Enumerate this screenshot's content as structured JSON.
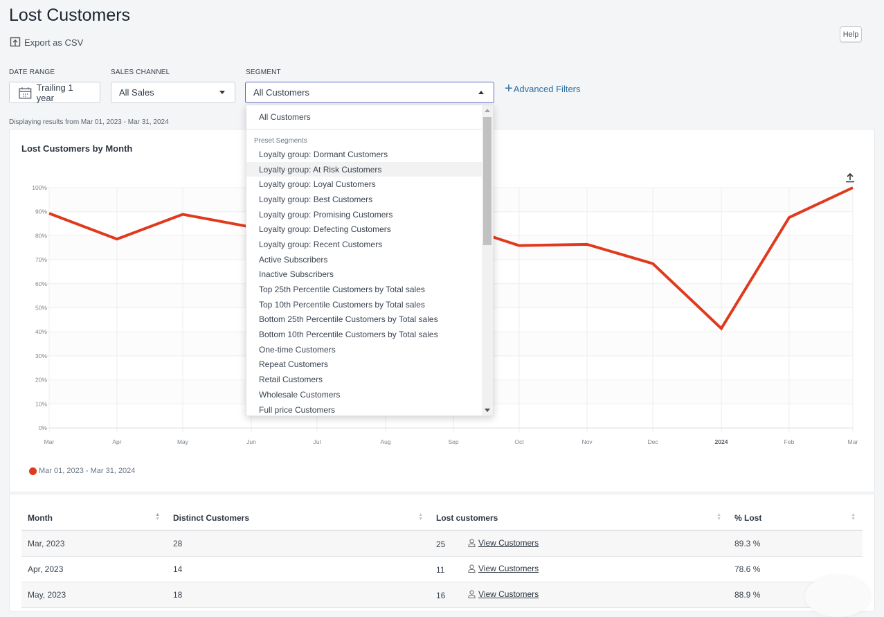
{
  "page": {
    "title": "Lost Customers",
    "export_label": "Export as CSV",
    "help_label": "Help",
    "display_text": "Displaying results from Mar 01, 2023 - Mar 31, 2024"
  },
  "filters": {
    "date_range": {
      "label": "DATE RANGE",
      "value": "Trailing 1 year"
    },
    "sales_channel": {
      "label": "SALES CHANNEL",
      "value": "All Sales"
    },
    "segment": {
      "label": "SEGMENT",
      "value": "All Customers"
    },
    "advanced_label": "Advanced Filters"
  },
  "segment_dropdown": {
    "top_option": "All Customers",
    "group_label": "Preset Segments",
    "hovered_option": "Loyalty group: At Risk Customers",
    "options": [
      "Loyalty group: Dormant Customers",
      "Loyalty group: At Risk Customers",
      "Loyalty group: Loyal Customers",
      "Loyalty group: Best Customers",
      "Loyalty group: Promising Customers",
      "Loyalty group: Defecting Customers",
      "Loyalty group: Recent Customers",
      "Active Subscribers",
      "Inactive Subscribers",
      "Top 25th Percentile Customers by Total sales",
      "Top 10th Percentile Customers by Total sales",
      "Bottom 25th Percentile Customers by Total sales",
      "Bottom 10th Percentile Customers by Total sales",
      "One-time Customers",
      "Repeat Customers",
      "Retail Customers",
      "Wholesale Customers",
      "Full price Customers"
    ]
  },
  "chart_data": {
    "type": "line",
    "title": "Lost Customers by Month",
    "xlabel": "",
    "ylabel": "",
    "x": [
      "Mar",
      "Apr",
      "May",
      "Jun",
      "Jul",
      "Aug",
      "Sep",
      "Oct",
      "Nov",
      "Dec",
      "2024",
      "Feb",
      "Mar"
    ],
    "y_ticks": [
      "0%",
      "10%",
      "20%",
      "30%",
      "40%",
      "50%",
      "60%",
      "70%",
      "80%",
      "90%",
      "100%"
    ],
    "ylim": [
      0,
      100
    ],
    "grid": true,
    "legend_position": "bottom-left",
    "series": [
      {
        "name": "Mar 01, 2023 - Mar 31, 2024",
        "color": "#e03a1e",
        "values": [
          89.3,
          78.6,
          88.9,
          83.6,
          82.5,
          83.5,
          84.8,
          75.9,
          76.4,
          68.4,
          41.4,
          87.6,
          100
        ]
      }
    ]
  },
  "table": {
    "columns": [
      "Month",
      "Distinct Customers",
      "Lost customers",
      "% Lost"
    ],
    "view_label": "View Customers",
    "rows": [
      {
        "month": "Mar, 2023",
        "distinct": "28",
        "lost": "25",
        "pct": "89.3 %"
      },
      {
        "month": "Apr, 2023",
        "distinct": "14",
        "lost": "11",
        "pct": "78.6 %"
      },
      {
        "month": "May, 2023",
        "distinct": "18",
        "lost": "16",
        "pct": "88.9 %"
      }
    ]
  }
}
